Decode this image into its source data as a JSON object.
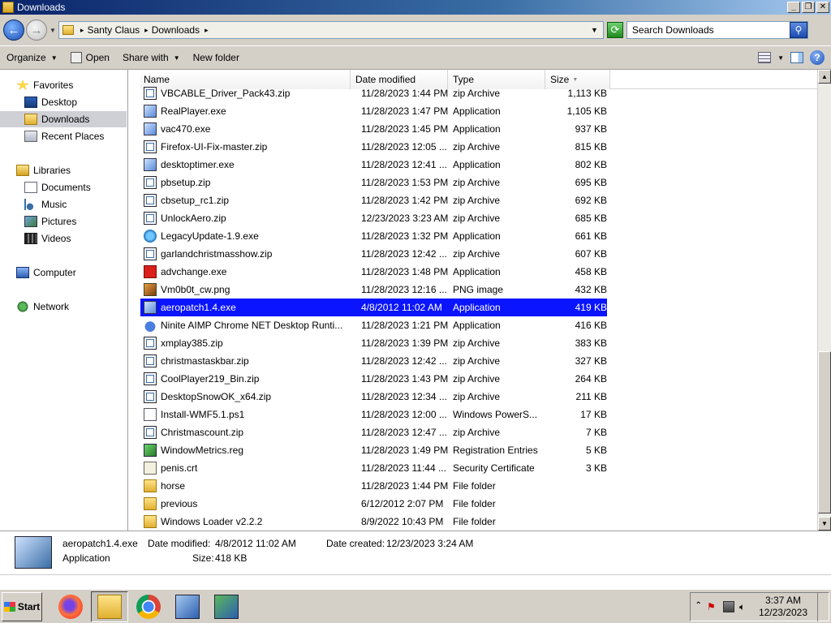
{
  "window": {
    "title": "Downloads"
  },
  "address": {
    "crumbs": [
      "Santy Claus",
      "Downloads"
    ],
    "search_placeholder": "Search Downloads"
  },
  "toolbar": {
    "organize": "Organize",
    "open": "Open",
    "share_with": "Share with",
    "new_folder": "New folder"
  },
  "nav": {
    "favorites": "Favorites",
    "desktop": "Desktop",
    "downloads": "Downloads",
    "recent": "Recent Places",
    "libraries": "Libraries",
    "documents": "Documents",
    "music": "Music",
    "pictures": "Pictures",
    "videos": "Videos",
    "computer": "Computer",
    "network": "Network"
  },
  "columns": {
    "name": "Name",
    "date": "Date modified",
    "type": "Type",
    "size": "Size"
  },
  "files": [
    {
      "name": "VBCABLE_Driver_Pack43.zip",
      "date": "11/28/2023 1:44 PM",
      "type": "zip Archive",
      "size": "1,113 KB",
      "icon": "zip"
    },
    {
      "name": "RealPlayer.exe",
      "date": "11/28/2023 1:47 PM",
      "type": "Application",
      "size": "1,105 KB",
      "icon": "exe"
    },
    {
      "name": "vac470.exe",
      "date": "11/28/2023 1:45 PM",
      "type": "Application",
      "size": "937 KB",
      "icon": "exe"
    },
    {
      "name": "Firefox-UI-Fix-master.zip",
      "date": "11/28/2023 12:05 ...",
      "type": "zip Archive",
      "size": "815 KB",
      "icon": "zip"
    },
    {
      "name": "desktoptimer.exe",
      "date": "11/28/2023 12:41 ...",
      "type": "Application",
      "size": "802 KB",
      "icon": "exe"
    },
    {
      "name": "pbsetup.zip",
      "date": "11/28/2023 1:53 PM",
      "type": "zip Archive",
      "size": "695 KB",
      "icon": "zip"
    },
    {
      "name": "cbsetup_rc1.zip",
      "date": "11/28/2023 1:42 PM",
      "type": "zip Archive",
      "size": "692 KB",
      "icon": "zip"
    },
    {
      "name": "UnlockAero.zip",
      "date": "12/23/2023 3:23 AM",
      "type": "zip Archive",
      "size": "685 KB",
      "icon": "zip"
    },
    {
      "name": "LegacyUpdate-1.9.exe",
      "date": "11/28/2023 1:32 PM",
      "type": "Application",
      "size": "661 KB",
      "icon": "glob"
    },
    {
      "name": "garlandchristmasshow.zip",
      "date": "11/28/2023 12:42 ...",
      "type": "zip Archive",
      "size": "607 KB",
      "icon": "zip"
    },
    {
      "name": "advchange.exe",
      "date": "11/28/2023 1:48 PM",
      "type": "Application",
      "size": "458 KB",
      "icon": "red"
    },
    {
      "name": "Vm0b0t_cw.png",
      "date": "11/28/2023 12:16 ...",
      "type": "PNG image",
      "size": "432 KB",
      "icon": "png"
    },
    {
      "name": "aeropatch1.4.exe",
      "date": "4/8/2012 11:02 AM",
      "type": "Application",
      "size": "419 KB",
      "icon": "exe",
      "selected": true
    },
    {
      "name": "Ninite AIMP Chrome NET Desktop Runti...",
      "date": "11/28/2023 1:21 PM",
      "type": "Application",
      "size": "416 KB",
      "icon": "ninite"
    },
    {
      "name": "xmplay385.zip",
      "date": "11/28/2023 1:39 PM",
      "type": "zip Archive",
      "size": "383 KB",
      "icon": "zip"
    },
    {
      "name": "christmastaskbar.zip",
      "date": "11/28/2023 12:42 ...",
      "type": "zip Archive",
      "size": "327 KB",
      "icon": "zip"
    },
    {
      "name": "CoolPlayer219_Bin.zip",
      "date": "11/28/2023 1:43 PM",
      "type": "zip Archive",
      "size": "264 KB",
      "icon": "zip"
    },
    {
      "name": "DesktopSnowOK_x64.zip",
      "date": "11/28/2023 12:34 ...",
      "type": "zip Archive",
      "size": "211 KB",
      "icon": "zip"
    },
    {
      "name": "Install-WMF5.1.ps1",
      "date": "11/28/2023 12:00 ...",
      "type": "Windows PowerS...",
      "size": "17 KB",
      "icon": "ps1"
    },
    {
      "name": "Christmascount.zip",
      "date": "11/28/2023 12:47 ...",
      "type": "zip Archive",
      "size": "7 KB",
      "icon": "zip"
    },
    {
      "name": "WindowMetrics.reg",
      "date": "11/28/2023 1:49 PM",
      "type": "Registration Entries",
      "size": "5 KB",
      "icon": "reg"
    },
    {
      "name": "penis.crt",
      "date": "11/28/2023 11:44 ...",
      "type": "Security Certificate",
      "size": "3 KB",
      "icon": "crt"
    },
    {
      "name": "horse",
      "date": "11/28/2023 1:44 PM",
      "type": "File folder",
      "size": "",
      "icon": "folder"
    },
    {
      "name": "previous",
      "date": "6/12/2012 2:07 PM",
      "type": "File folder",
      "size": "",
      "icon": "folder"
    },
    {
      "name": "Windows Loader v2.2.2",
      "date": "8/9/2022 10:43 PM",
      "type": "File folder",
      "size": "",
      "icon": "folder"
    }
  ],
  "details": {
    "name": "aeropatch1.4.exe",
    "kind": "Application",
    "modified_label": "Date modified:",
    "modified_value": "4/8/2012 11:02 AM",
    "created_label": "Date created:",
    "created_value": "12/23/2023 3:24 AM",
    "size_label": "Size:",
    "size_value": "418 KB"
  },
  "taskbar": {
    "start": "Start",
    "time": "3:37 AM",
    "date": "12/23/2023"
  },
  "colors": {
    "selection": "#0a14ff",
    "title_start": "#0a246a",
    "chrome": "#d4d0c8"
  }
}
